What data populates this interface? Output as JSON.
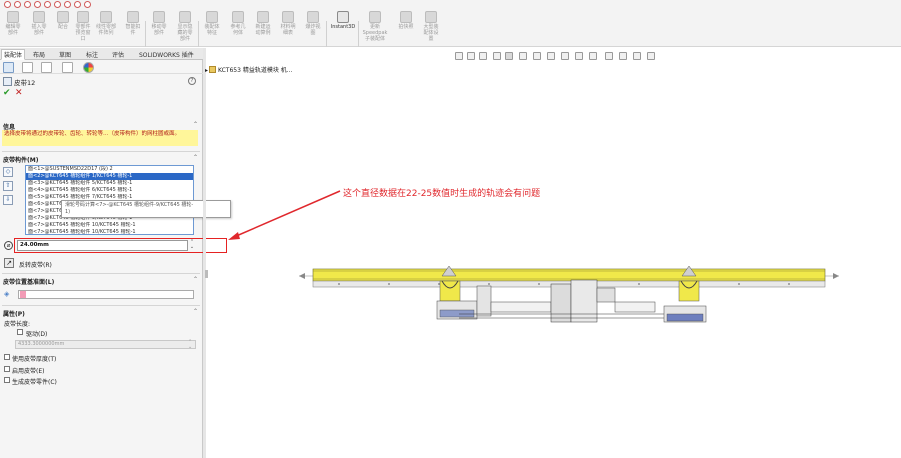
{
  "ribbon": {
    "buttons": [
      {
        "label": "编辑零\n部件"
      },
      {
        "label": "插入零\n部件"
      },
      {
        "label": "配合"
      },
      {
        "label": "零部件\n预览窗\n口"
      },
      {
        "label": "线性零部\n件阵列"
      },
      {
        "label": "智能扣\n件"
      },
      {
        "label": "移动零\n部件"
      },
      {
        "label": "显示隐\n藏的零\n部件"
      },
      {
        "label": "装配体\n特征"
      },
      {
        "label": "参考几\n何体"
      },
      {
        "label": "新建运\n动算例"
      },
      {
        "label": "材料明\n细表"
      },
      {
        "label": "爆炸视\n图"
      },
      {
        "label": "Instant3D"
      },
      {
        "label": "更新\nSpeedpak\n子装配体"
      },
      {
        "label": "拍快照"
      },
      {
        "label": "大型装\n配体设\n置"
      }
    ]
  },
  "tabs": [
    "装配体",
    "布局",
    "草图",
    "标注",
    "评估",
    "SOLIDWORKS 插件"
  ],
  "feature": {
    "title": "皮带12",
    "help": "?"
  },
  "message": {
    "header": "信息",
    "text": "选择皮带将通过的皮带轮、齿轮、转轮等…（皮带构件）的网柱圆或面。"
  },
  "belt_members": {
    "header": "皮带构件(M)",
    "rows": [
      {
        "text": "面<1>@SUSTENMSD22D17 (段) 2",
        "selected": false
      },
      {
        "text": "面<2>@KCT645 槽轮组件 1/KCT645 槽轮-1",
        "selected": true
      },
      {
        "text": "面<3>@KCT645 槽轮组件 5/KCT645 槽轮-1",
        "selected": false
      },
      {
        "text": "面<4>@KCT645 槽轮组件 6/KCT645 槽轮-1",
        "selected": false
      },
      {
        "text": "面<5>@KCT645 槽轮组件 7/KCT645 槽轮-1",
        "selected": false
      },
      {
        "text": "面<6>@KCT645 槽轮组件 8/KCT645 槽轮-1",
        "selected": false
      },
      {
        "text": "面<7>@KCT645 槽轮组件 9/KCT645 槽轮-1",
        "selected": false
      },
      {
        "text": "面<7>@KCT645 槽轮组件 9/KCT645 槽轮-1",
        "selected": false
      },
      {
        "text": "面<7>@KCT645 槽轮组件 10/KCT645 槽轮-1",
        "selected": false
      },
      {
        "text": "面<7>@KCT645 槽轮组件 10/KCT645 槽轮-1",
        "selected": false
      }
    ],
    "tooltip": "滑轮号码计算<7>-@KCT645 槽轮组件-9/KCT645 槽轮-\n1)",
    "diameter_value": "24.00mm",
    "reverse_label": "反转皮带(R)"
  },
  "belt_plane": {
    "header": "皮带位置基准面(L)"
  },
  "properties": {
    "header": "属性(P)",
    "length_label": "皮带长度:",
    "driving_label": "驱动(D)",
    "length_value": "4333.3000000mm",
    "use_thickness": "使用皮带厚度(T)",
    "enable_belt": "启用皮带(E)",
    "create_part": "生成皮带零件(C)"
  },
  "graphics": {
    "tree_item": "KCT653 精益轨道模块 机...",
    "annotation": "这个直径数据在22-25数值时生成的轨迹会有问题"
  },
  "colors": {
    "annotation": "#e0282d",
    "highlight_box": "#e52222",
    "rail_yellow": "#f0e84a",
    "selection_blue": "#2b68c6",
    "message_bg": "#fff69a"
  }
}
